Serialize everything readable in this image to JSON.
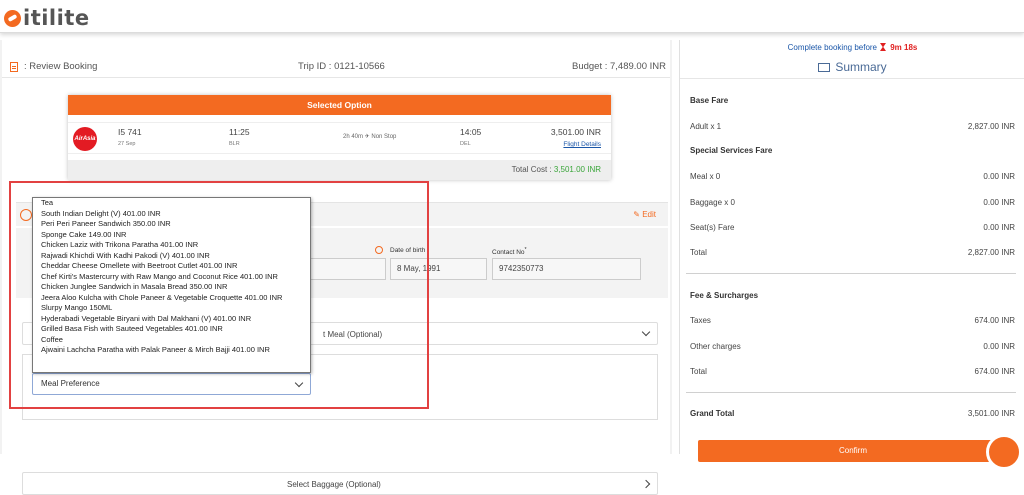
{
  "brand": {
    "name": "itilite",
    "color": "#f36a21"
  },
  "header": {
    "review_label": ": Review Booking",
    "trip_id": "Trip ID : 0121-10566",
    "budget": "Budget : 7,489.00 INR"
  },
  "selected_option": {
    "title": "Selected Option",
    "airline_logo": "AirAsia",
    "flight_no": "I5 741",
    "date": "27 Sep",
    "dep_time": "11:25",
    "dep_city": "BLR",
    "duration": "2h 40m ✈ Non Stop",
    "arr_time": "14:05",
    "arr_city": "DEL",
    "fare": "3,501.00 INR",
    "details_link": "Flight Details",
    "total_label": "Total Cost : ",
    "total_value": "3,501.00 INR"
  },
  "traveller": {
    "edit_label": "Edit",
    "dob_label": "Date of birth",
    "dob_value": "8 May, 1991",
    "contact_label": "Contact No",
    "contact_required": "*",
    "contact_value": "9742350773"
  },
  "meal": {
    "row_label": "t Meal (Optional)",
    "select_value": "Meal Preference",
    "options": [
      "Tea",
      "South Indian Delight (V) 401.00 INR",
      "Peri Peri Paneer Sandwich 350.00 INR",
      "Sponge Cake 149.00 INR",
      "Chicken Laziz with Trikona Paratha 401.00 INR",
      "Rajwadi Khichdi With Kadhi Pakodi (V) 401.00 INR",
      "Cheddar Cheese Omellete with Beetroot Cutlet 401.00 INR",
      "Chef Kirti's Mastercurry with Raw Mango and Coconut Rice 401.00 INR",
      "Chicken Junglee Sandwich in Masala Bread 350.00 INR",
      "Jeera Aloo Kulcha with Chole Paneer & Vegetable Croquette 401.00 INR",
      "Slurpy Mango 150ML",
      "Hyderabadi Vegetable Biryani with Dal Makhani (V) 401.00 INR",
      "Grilled Basa Fish with Sauteed Vegetables 401.00 INR",
      "Coffee",
      "Ajwaini Lachcha Paratha with Palak Paneer & Mirch Bajji 401.00 INR"
    ]
  },
  "baggage": {
    "label": "Select Baggage (Optional)"
  },
  "summary": {
    "countdown_label": "Complete booking before",
    "countdown_time": "9m 18s",
    "title": "Summary",
    "base_fare": "Base Fare",
    "adult_label": "Adult x 1",
    "adult_value": "2,827.00 INR",
    "special_services": "Special Services Fare",
    "meal_label": "Meal x 0",
    "meal_value": "0.00 INR",
    "baggage_label": "Baggage x 0",
    "baggage_value": "0.00 INR",
    "seat_label": "Seat(s) Fare",
    "seat_value": "0.00 INR",
    "total1_label": "Total",
    "total1_value": "2,827.00 INR",
    "fee_surcharges": "Fee & Surcharges",
    "taxes_label": "Taxes",
    "taxes_value": "674.00 INR",
    "other_label": "Other charges",
    "other_value": "0.00 INR",
    "total2_label": "Total",
    "total2_value": "674.00 INR",
    "grand_label": "Grand Total",
    "grand_value": "3,501.00 INR",
    "confirm_label": "Confirm"
  }
}
